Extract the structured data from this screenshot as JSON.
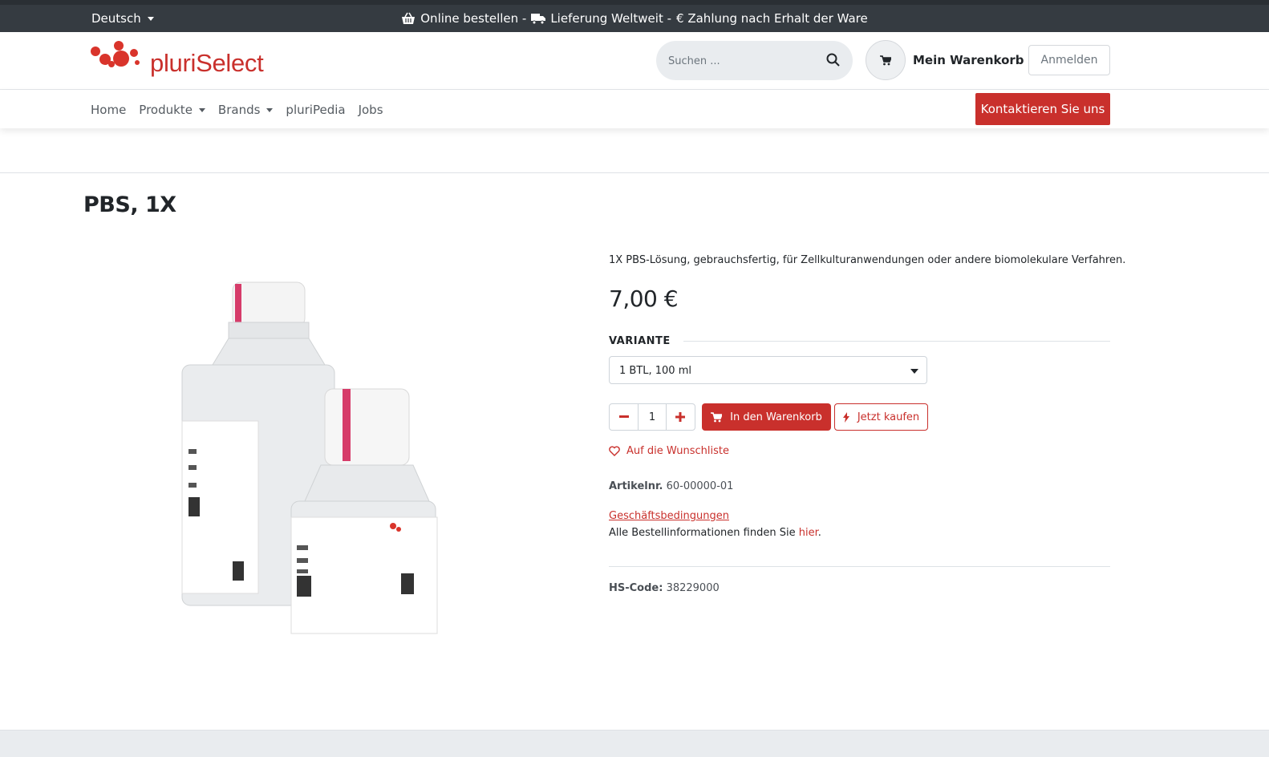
{
  "topbar": {
    "language": "Deutsch",
    "promo_part1": "Online bestellen -",
    "promo_part2": "Lieferung Weltweit -",
    "promo_part3": "€ Zahlung nach Erhalt der Ware"
  },
  "header": {
    "logo_text": "pluriSelect",
    "search_placeholder": "Suchen ...",
    "cart_label": "Mein Warenkorb",
    "login_label": "Anmelden"
  },
  "nav": {
    "items": [
      "Home",
      "Produkte",
      "Brands",
      "pluriPedia",
      "Jobs"
    ],
    "contact_label": "Kontaktieren Sie uns"
  },
  "product": {
    "title": "PBS, 1X",
    "description": "1X PBS-Lösung, gebrauchsfertig, für Zellkulturanwendungen oder andere biomolekulare Verfahren.",
    "price": "7,00 €",
    "variant_label": "VARIANTE",
    "variant_selected": "1 BTL, 100 ml",
    "quantity": "1",
    "add_to_cart_label": "In den Warenkorb",
    "buy_now_label": "Jetzt kaufen",
    "wishlist_label": "Auf die Wunschliste",
    "sku_label": "Artikelnr.",
    "sku_value": "60-00000-01",
    "terms_label": "Geschäftsbedingungen",
    "order_info_text": "Alle Bestellinformationen finden Sie",
    "order_info_link": "hier",
    "order_info_end": ".",
    "hs_label": "HS-Code:",
    "hs_value": "38229000"
  },
  "colors": {
    "brand_red": "#c9302c",
    "topbar": "#353b41"
  }
}
